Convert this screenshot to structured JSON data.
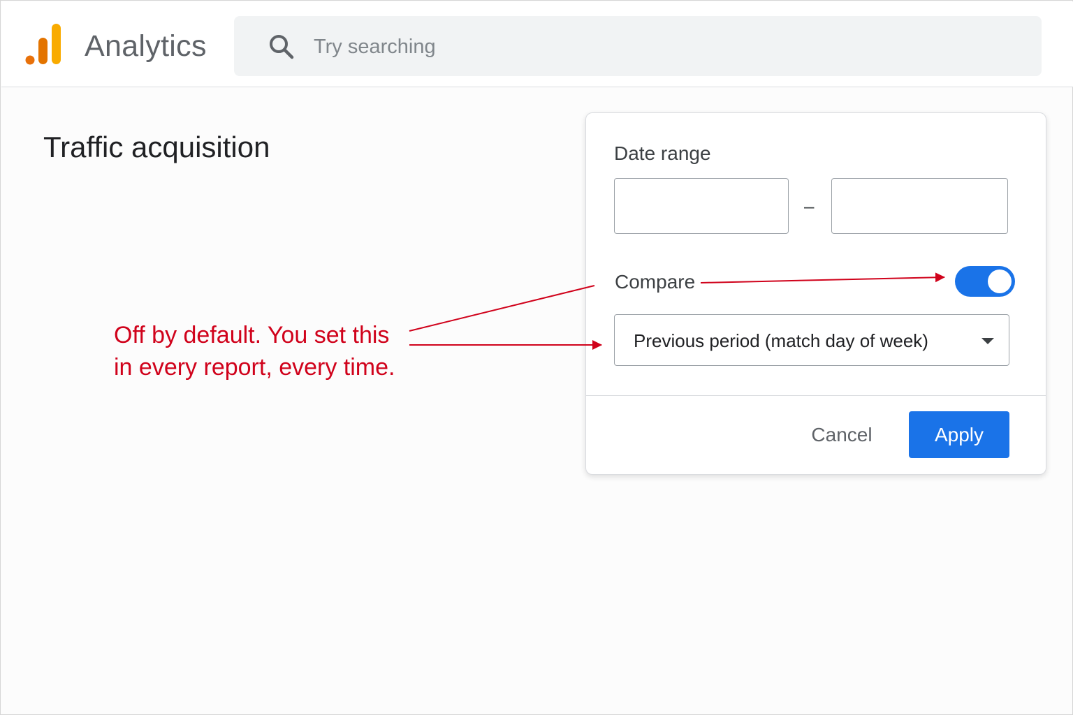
{
  "header": {
    "app_title": "Analytics",
    "search_placeholder": "Try searching",
    "logo_colors": [
      "#F9AB00",
      "#E37400",
      "#E8710A"
    ]
  },
  "page": {
    "title": "Traffic acquisition"
  },
  "dialog": {
    "date_range_label": "Date range",
    "date_start_value": "",
    "date_end_value": "",
    "date_separator": "–",
    "compare_label": "Compare",
    "compare_enabled": true,
    "compare_option": "Previous period (match day of week)",
    "cancel_label": "Cancel",
    "apply_label": "Apply"
  },
  "annotation": {
    "line1": "Off by default. You set this",
    "line2": "in every report, every time.",
    "color": "#D0021B"
  },
  "colors": {
    "accent": "#1A73E8"
  }
}
